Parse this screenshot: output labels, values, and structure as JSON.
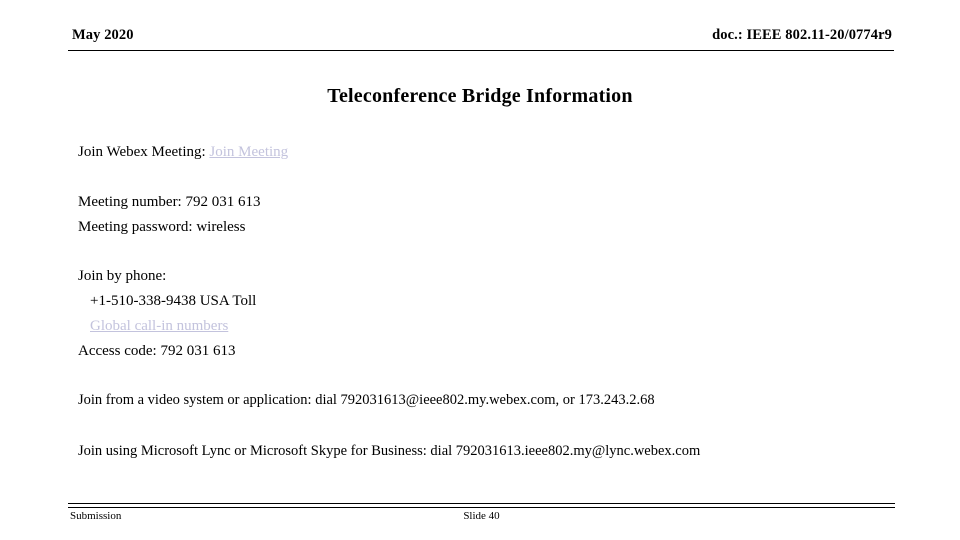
{
  "header": {
    "date": "May 2020",
    "doc": "doc.: IEEE 802.11-20/0774r9"
  },
  "title": "Teleconference Bridge Information",
  "body": {
    "join_webex_label": "Join Webex Meeting:",
    "join_meeting_link": "Join Meeting",
    "meeting_number": "Meeting number:  792 031 613",
    "meeting_password": "Meeting password:  wireless",
    "join_by_phone_label": "Join by phone:",
    "phone_number": "+1-510-338-9438 USA Toll",
    "global_call_in_link": "Global call-in numbers",
    "access_code": "Access code:  792 031 613",
    "video_system": "Join from a video system or application: dial 792031613@ieee802.my.webex.com, or 173.243.2.68",
    "lync_skype": "Join using Microsoft Lync or Microsoft Skype for Business: dial 792031613.ieee802.my@lync.webex.com"
  },
  "footer": {
    "left": "Submission",
    "center": "Slide 40"
  },
  "colors": {
    "link": "#c3c3dd",
    "text": "#000000",
    "background": "#ffffff"
  }
}
